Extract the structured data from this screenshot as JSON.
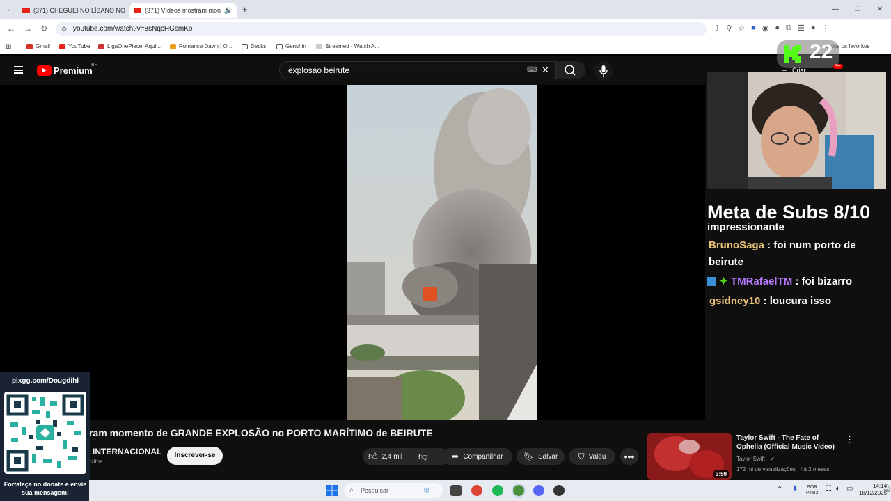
{
  "browser": {
    "tabs": [
      {
        "label": "(371) CHEGUEI NO LÍBANO NO",
        "active": false
      },
      {
        "label": "(371) Vídeos mostram mon",
        "active": true
      }
    ],
    "url": "youtube.com/watch?v=8sNqcHGsmKo",
    "bookmarks": [
      "Gmail",
      "YouTube",
      "LigaOnePiece: Aqui...",
      "Romance Dawn | O...",
      "Decks",
      "Genshin",
      "Streamed - Watch A..."
    ],
    "all_bookmarks": "Todos os favoritos"
  },
  "youtube": {
    "logo_text": "Premium",
    "region": "BR",
    "search_query": "explosao beirute",
    "video_title": "ram momento de GRANDE EXPLOSÃO no PORTO MARÍTIMO de BEIRUTE",
    "channel_name": "INTERNACIONAL",
    "channel_sub_fragment": "critos",
    "subscribe_label": "Inscrever-se",
    "likes": "2,4 mil",
    "share_label": "Compartilhar",
    "save_label": "Salvar",
    "thanks_label": "Valeu",
    "create_label": "Criar",
    "notif_badge": "9+",
    "recommended": {
      "title": "Taylor Swift - The Fate of Ophelia (Official Music Video)",
      "channel": "Taylor Swift",
      "meta": "172 mi de visualizações · há 2 meses",
      "duration": "3:59"
    }
  },
  "stream_overlay": {
    "counter": "22",
    "meta_subs": "Meta de Subs 8/10",
    "chat": [
      {
        "user": "",
        "text": "impressionante",
        "color": "#ffffff"
      },
      {
        "user": "BrunoSaga",
        "text": " : foi num porto de beirute",
        "color": "#e8c27a"
      },
      {
        "user": "TMRafaelTM",
        "text": " : foi bizarro",
        "color": "#b678ff"
      },
      {
        "user": "gsidney10",
        "text": " : loucura isso",
        "color": "#e8c27a"
      }
    ],
    "pix_url": "pixgg.com/Dougdihl",
    "pix_caption": "Fortaleça no donate e envie sua mensagem!"
  },
  "taskbar": {
    "search_placeholder": "Pesquisar",
    "lang": "POR",
    "lang2": "PTB2",
    "time": "14:14",
    "date": "18/12/2025"
  }
}
